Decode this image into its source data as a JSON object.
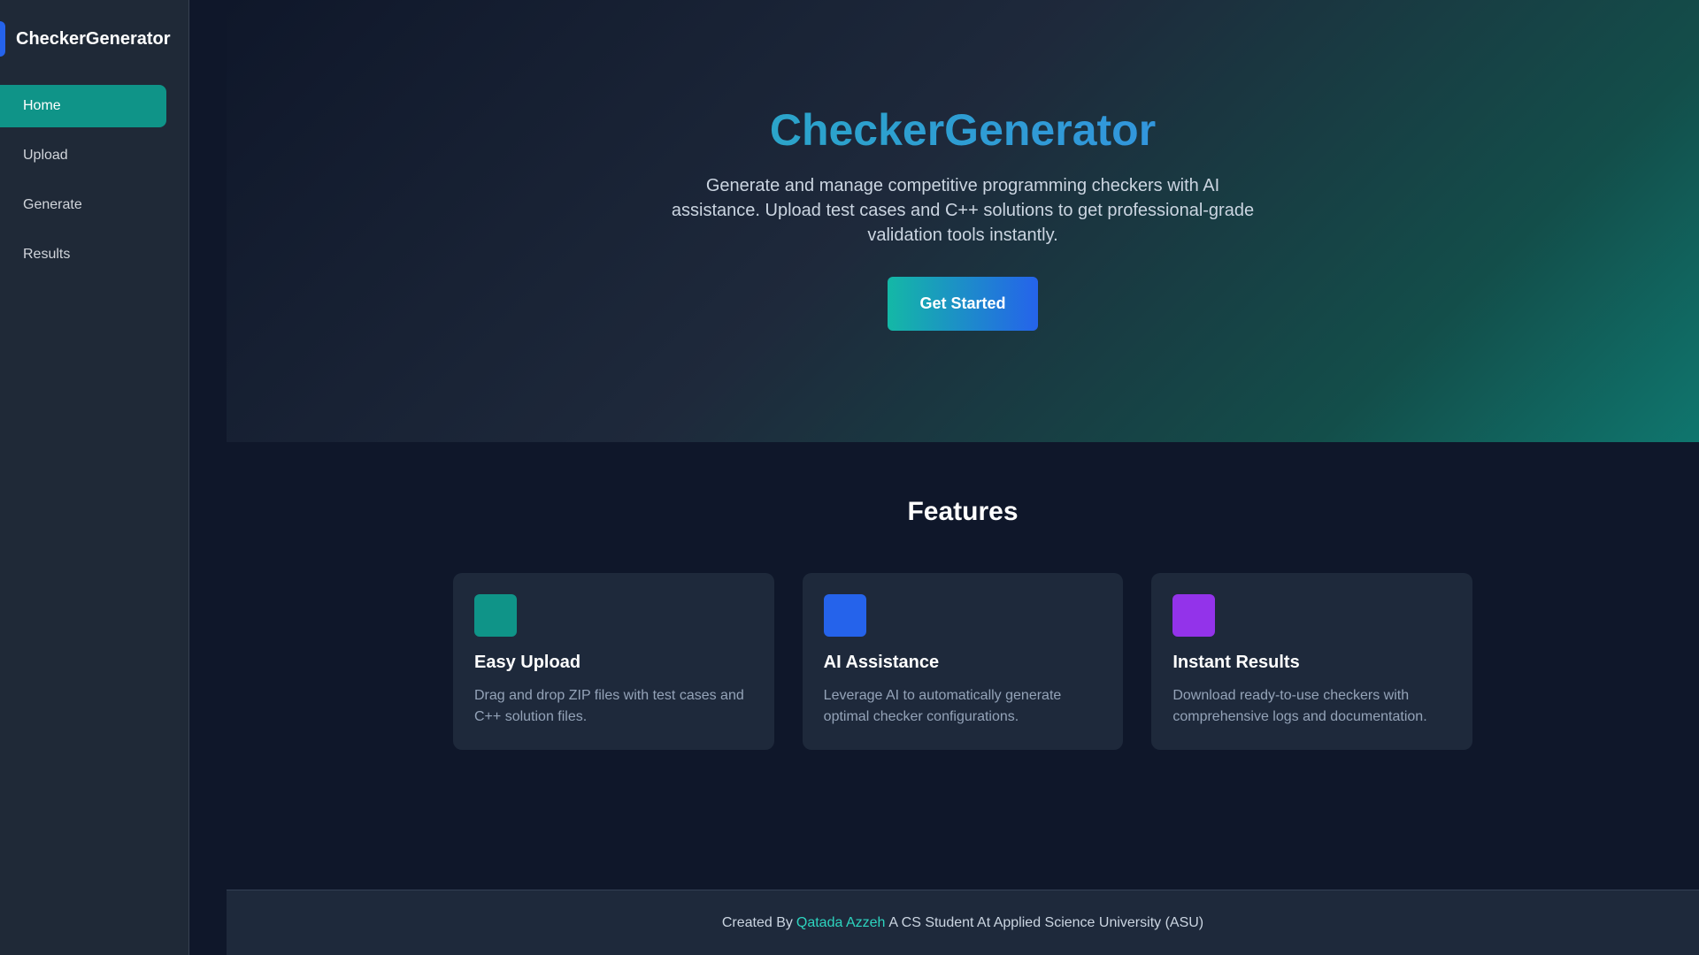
{
  "brand": {
    "name": "CheckerGenerator"
  },
  "sidebar": {
    "items": [
      {
        "label": "Home",
        "active": true
      },
      {
        "label": "Upload",
        "active": false
      },
      {
        "label": "Generate",
        "active": false
      },
      {
        "label": "Results",
        "active": false
      }
    ]
  },
  "hero": {
    "title": "CheckerGenerator",
    "subtitle": "Generate and manage competitive programming checkers with AI assistance. Upload test cases and C++ solutions to get professional-grade validation tools instantly.",
    "cta_label": "Get Started"
  },
  "features": {
    "title": "Features",
    "cards": [
      {
        "title": "Easy Upload",
        "desc": "Drag and drop ZIP files with test cases and C++ solution files.",
        "icon": "upload-icon",
        "color": "#0f9488"
      },
      {
        "title": "AI Assistance",
        "desc": "Leverage AI to automatically generate optimal checker configurations.",
        "icon": "ai-icon",
        "color": "#2563eb"
      },
      {
        "title": "Instant Results",
        "desc": "Download ready-to-use checkers with comprehensive logs and documentation.",
        "icon": "results-icon",
        "color": "#9333ea"
      }
    ]
  },
  "footer": {
    "prefix": "Created By",
    "author": "Qatada Azzeh",
    "suffix": "A CS Student At Applied Science University (ASU)"
  },
  "colors": {
    "accent_teal": "#0f9488",
    "accent_blue": "#2563eb",
    "accent_purple": "#9333ea",
    "background": "#0f172a"
  }
}
